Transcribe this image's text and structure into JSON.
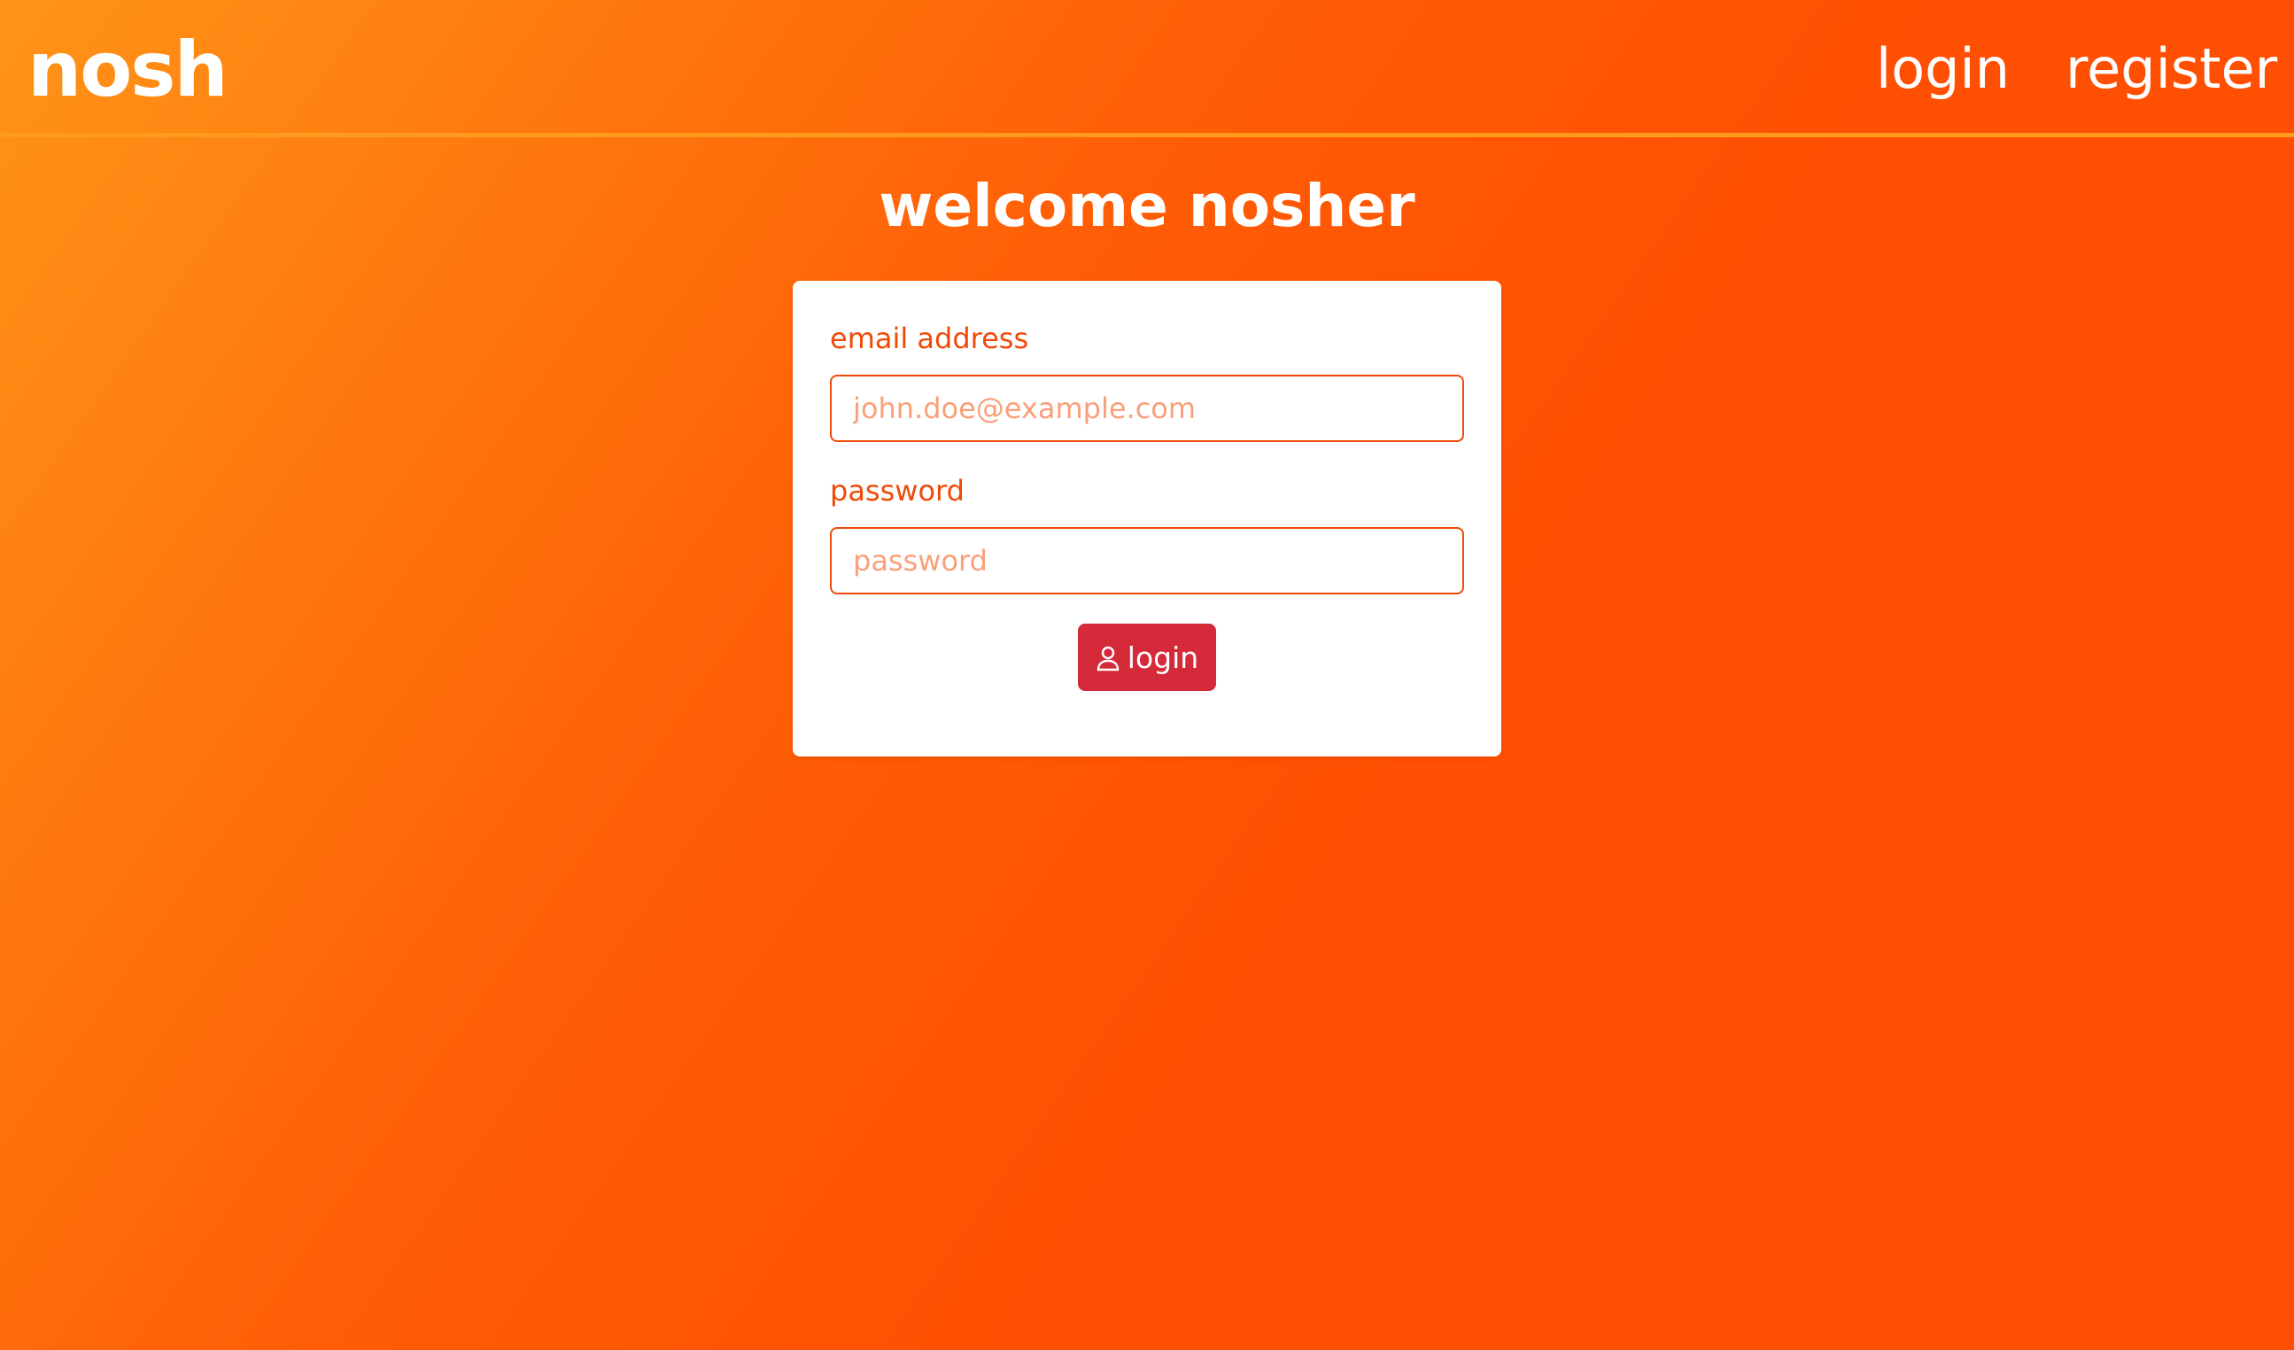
{
  "header": {
    "logo_text": "nosh",
    "nav": {
      "login_label": "login",
      "register_label": "register"
    }
  },
  "main": {
    "title": "welcome nosher",
    "form": {
      "email": {
        "label": "email address",
        "placeholder": "john.doe@example.com",
        "value": ""
      },
      "password": {
        "label": "password",
        "placeholder": "password",
        "value": ""
      },
      "submit": {
        "label": "login",
        "icon": "user-icon"
      }
    }
  },
  "colors": {
    "gradient_start": "#ff9418",
    "gradient_end": "#ff4f02",
    "accent": "#f04a08",
    "button": "#d42a39",
    "card_background": "#ffffff"
  }
}
